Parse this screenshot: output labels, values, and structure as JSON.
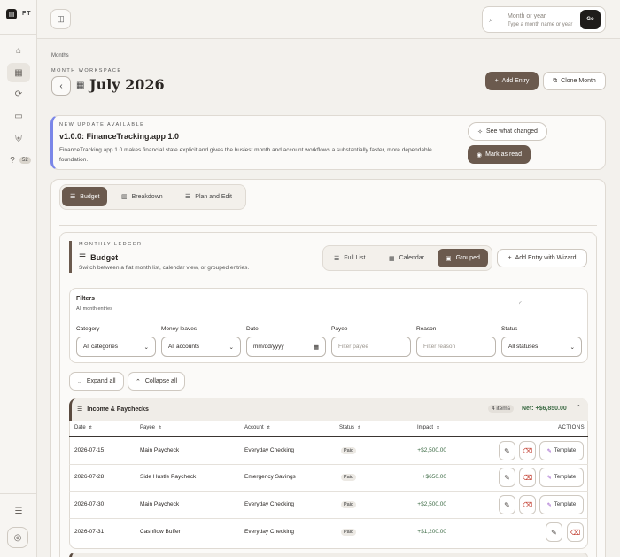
{
  "app": {
    "logo_text": "FT"
  },
  "sidebar": {
    "items": [
      {
        "name": "home",
        "icon": "home-icon"
      },
      {
        "name": "months",
        "icon": "calendar-icon",
        "active": true
      },
      {
        "name": "sync",
        "icon": "refresh-icon"
      },
      {
        "name": "accounts",
        "icon": "card-icon"
      },
      {
        "name": "security",
        "icon": "shield-icon"
      },
      {
        "name": "help",
        "icon": "help-icon",
        "badge": "52"
      }
    ]
  },
  "search": {
    "title": "Month or year",
    "placeholder": "Type a month name or year",
    "go": "Go"
  },
  "header": {
    "breadcrumb": "Months",
    "workspace_label": "MONTH WORKSPACE",
    "title": "July 2026",
    "add_entry": "Add Entry",
    "clone_month": "Clone Month"
  },
  "update": {
    "label": "NEW UPDATE AVAILABLE",
    "title": "v1.0.0: FinanceTracking.app 1.0",
    "body": "FinanceTracking.app 1.0 makes financial state explicit and gives the busiest month and account workflows a substantially faster, more dependable foundation.",
    "see_changed": "See what changed",
    "mark_read": "Mark as read"
  },
  "tabs": [
    {
      "label": "Budget",
      "active": true
    },
    {
      "label": "Breakdown"
    },
    {
      "label": "Plan and Edit"
    }
  ],
  "ledger": {
    "label": "MONTHLY LEDGER",
    "title": "Budget",
    "subtitle": "Switch between a flat month list, calendar view, or grouped entries.",
    "views": [
      {
        "label": "Full List"
      },
      {
        "label": "Calendar"
      },
      {
        "label": "Grouped",
        "active": true
      }
    ],
    "wizard": "Add Entry with Wizard"
  },
  "filters": {
    "title": "Filters",
    "subtitle": "All month entries",
    "fields": [
      {
        "label": "Category",
        "value": "All categories",
        "type": "select"
      },
      {
        "label": "Money leaves",
        "value": "All accounts",
        "type": "select"
      },
      {
        "label": "Date",
        "value": "mm/dd/yyyy",
        "type": "date"
      },
      {
        "label": "Payee",
        "placeholder": "Filter payee",
        "type": "text"
      },
      {
        "label": "Reason",
        "placeholder": "Filter reason",
        "type": "text"
      },
      {
        "label": "Status",
        "value": "All statuses",
        "type": "select"
      }
    ]
  },
  "expand_all": "Expand all",
  "collapse_all": "Collapse all",
  "group": {
    "title": "Income & Paychecks",
    "count": "4 items",
    "net": "Net: +$6,850.00"
  },
  "columns": {
    "date": "Date",
    "payee": "Payee",
    "account": "Account",
    "status": "Status",
    "impact": "Impact",
    "actions": "ACTIONS"
  },
  "template_label": "Template",
  "rows": [
    {
      "date": "2026-07-15",
      "payee": "Main Paycheck",
      "account": "Everyday Checking",
      "status": "Paid",
      "impact": "+$2,500.00",
      "template": true
    },
    {
      "date": "2026-07-28",
      "payee": "Side Hustle Paycheck",
      "account": "Emergency Savings",
      "status": "Paid",
      "impact": "+$650.00",
      "template": true
    },
    {
      "date": "2026-07-30",
      "payee": "Main Paycheck",
      "account": "Everyday Checking",
      "status": "Paid",
      "impact": "+$2,500.00",
      "template": true
    },
    {
      "date": "2026-07-31",
      "payee": "Cashflow Buffer",
      "account": "Everyday Checking",
      "status": "Paid",
      "impact": "+$1,200.00",
      "template": false
    }
  ],
  "colors": {
    "accent": "#6b5a4e",
    "positive": "#3d6b45",
    "update_border": "#7a86e8",
    "delete": "#c0392b",
    "template": "#8a3fc0"
  }
}
